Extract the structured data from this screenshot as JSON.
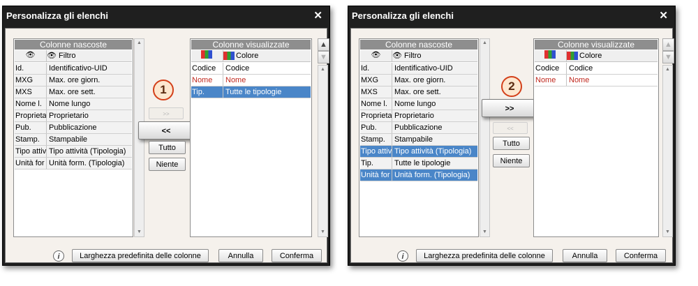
{
  "dialogs": [
    {
      "title": "Personalizza gli elenchi",
      "close_symbol": "✕",
      "step_number": "1",
      "hidden": {
        "header": "Colonne nascoste",
        "filter_label": "Filtro",
        "rows": [
          {
            "code": "Id.",
            "name": "Identificativo-UID",
            "selected": false
          },
          {
            "code": "MXG",
            "name": "Max. ore giorn.",
            "selected": false
          },
          {
            "code": "MXS",
            "name": "Max. ore sett.",
            "selected": false
          },
          {
            "code": "Nome l.",
            "name": "Nome lungo",
            "selected": false
          },
          {
            "code": "Proprieta",
            "name": "Proprietario",
            "selected": false
          },
          {
            "code": "Pub.",
            "name": "Pubblicazione",
            "selected": false
          },
          {
            "code": "Stamp.",
            "name": "Stampabile",
            "selected": false
          },
          {
            "code": "Tipo attivi",
            "name": "Tipo attività (Tipologia)",
            "selected": false
          },
          {
            "code": "Unità for",
            "name": "Unità form. (Tipologia)",
            "selected": false
          }
        ]
      },
      "visible": {
        "header": "Colonne visualizzate",
        "sub_left_icon": "color-grid-icon",
        "color_label": "Colore",
        "rows": [
          {
            "code": "Codice",
            "name": "Codice",
            "style": "normal"
          },
          {
            "code": "Nome",
            "name": "Nome",
            "style": "red"
          },
          {
            "code": "Tip.",
            "name": "Tutte le tipologie",
            "style": "selected"
          }
        ]
      },
      "buttons": {
        "add_small": ">>",
        "remove_big": "<<",
        "all": "Tutto",
        "none": "Niente"
      },
      "footer": {
        "info_symbol": "i",
        "default_width": "Larghezza predefinita delle colonne",
        "cancel": "Annulla",
        "confirm": "Conferma"
      }
    },
    {
      "title": "Personalizza gli elenchi",
      "close_symbol": "✕",
      "step_number": "2",
      "hidden": {
        "header": "Colonne nascoste",
        "filter_label": "Filtro",
        "rows": [
          {
            "code": "Id.",
            "name": "Identificativo-UID",
            "selected": false
          },
          {
            "code": "MXG",
            "name": "Max. ore giorn.",
            "selected": false
          },
          {
            "code": "MXS",
            "name": "Max. ore sett.",
            "selected": false
          },
          {
            "code": "Nome l.",
            "name": "Nome lungo",
            "selected": false
          },
          {
            "code": "Proprieta",
            "name": "Proprietario",
            "selected": false
          },
          {
            "code": "Pub.",
            "name": "Pubblicazione",
            "selected": false
          },
          {
            "code": "Stamp.",
            "name": "Stampabile",
            "selected": false
          },
          {
            "code": "Tipo attiv",
            "name": "Tipo attività (Tipologia)",
            "selected": true
          },
          {
            "code": "Tip.",
            "name": "Tutte le tipologie",
            "selected": false
          },
          {
            "code": "Unità for",
            "name": "Unità form. (Tipologia)",
            "selected": true
          }
        ]
      },
      "visible": {
        "header": "Colonne visualizzate",
        "sub_left_icon": "color-grid-icon",
        "color_label": "Colore",
        "rows": [
          {
            "code": "Codice",
            "name": "Codice",
            "style": "normal"
          },
          {
            "code": "Nome",
            "name": "Nome",
            "style": "red"
          }
        ]
      },
      "buttons": {
        "add_big": ">>",
        "remove_small": "<<",
        "all": "Tutto",
        "none": "Niente"
      },
      "footer": {
        "info_symbol": "i",
        "default_width": "Larghezza predefinita delle colonne",
        "cancel": "Annulla",
        "confirm": "Conferma"
      }
    }
  ],
  "icons": {
    "eye": "👁",
    "arrow_up": "▲",
    "arrow_down": "▼",
    "colors": {
      "selected_row": "#4a86c8",
      "red_text": "#c0281e",
      "badge_border": "#d3401a"
    }
  }
}
